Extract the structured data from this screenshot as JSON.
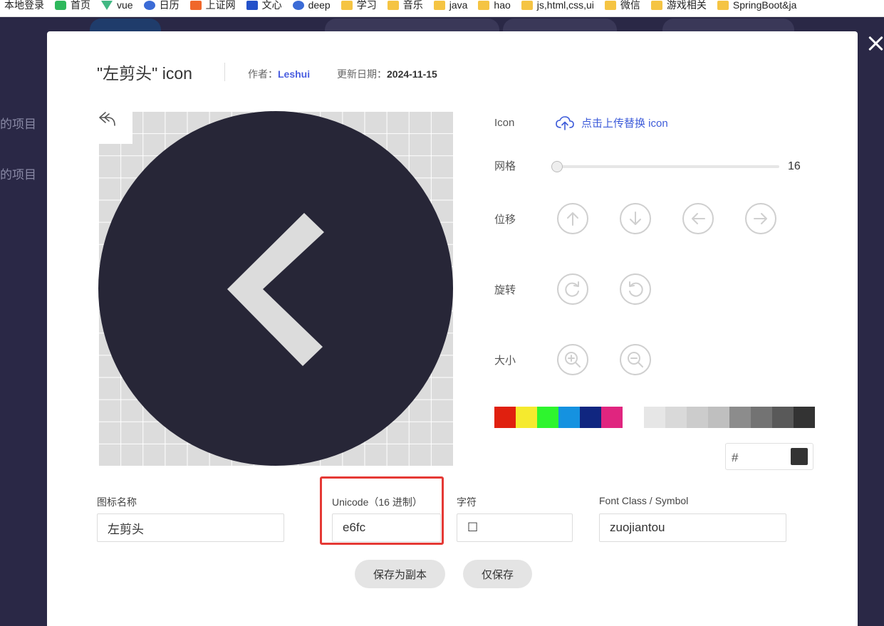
{
  "bookmarks": [
    {
      "label": "本地登录",
      "icon": "none"
    },
    {
      "label": "首页",
      "icon": "green-logo-icon"
    },
    {
      "label": "vue",
      "icon": "vue-icon"
    },
    {
      "label": "日历",
      "icon": "baidu-icon"
    },
    {
      "label": "上证网",
      "icon": "orange-logo-icon"
    },
    {
      "label": "文心",
      "icon": "wenxin-icon"
    },
    {
      "label": "deep",
      "icon": "baidu-icon"
    },
    {
      "label": "学习",
      "icon": "folder-icon"
    },
    {
      "label": "音乐",
      "icon": "folder-icon"
    },
    {
      "label": "java",
      "icon": "folder-icon"
    },
    {
      "label": "hao",
      "icon": "folder-icon"
    },
    {
      "label": "js,html,css,ui",
      "icon": "folder-icon"
    },
    {
      "label": "微信",
      "icon": "folder-icon"
    },
    {
      "label": "游戏相关",
      "icon": "folder-icon"
    },
    {
      "label": "SpringBoot&ja",
      "icon": "folder-icon"
    }
  ],
  "backdrop": {
    "items": [
      "的项目",
      "的项目"
    ]
  },
  "modal": {
    "title": "\"左剪头\" icon",
    "author_label": "作者：",
    "author": "Leshui",
    "date_label": "更新日期：",
    "date": "2024-11-15",
    "panel": {
      "icon_label": "Icon",
      "upload_label": "点击上传替换 icon",
      "grid_label": "网格",
      "grid_value": "16",
      "grid_fraction": 0.0,
      "move_label": "位移",
      "rotate_label": "旋转",
      "size_label": "大小",
      "hex_hash": "#",
      "hex_value": "",
      "selected_color": "#333333"
    },
    "colors_primary": [
      "#e0200f",
      "#f5ea2e",
      "#2ef52e",
      "#1592e0",
      "#102680",
      "#e0257f"
    ],
    "colors_gray": [
      "#e6e6e6",
      "#d9d9d9",
      "#cccccc",
      "#bfbfbf",
      "#8c8c8c",
      "#737373",
      "#595959",
      "#333333"
    ],
    "fields": {
      "name_label": "图标名称",
      "name_value": "左剪头",
      "unicode_label": "Unicode（16 进制）",
      "unicode_value": "e6fc",
      "char_label": "字符",
      "char_value": "☐",
      "class_label": "Font Class / Symbol",
      "class_value": "zuojiantou"
    },
    "buttons": {
      "save_copy": "保存为副本",
      "save_only": "仅保存"
    },
    "icon_fill": "#272637",
    "highlight_color": "#e53935"
  }
}
